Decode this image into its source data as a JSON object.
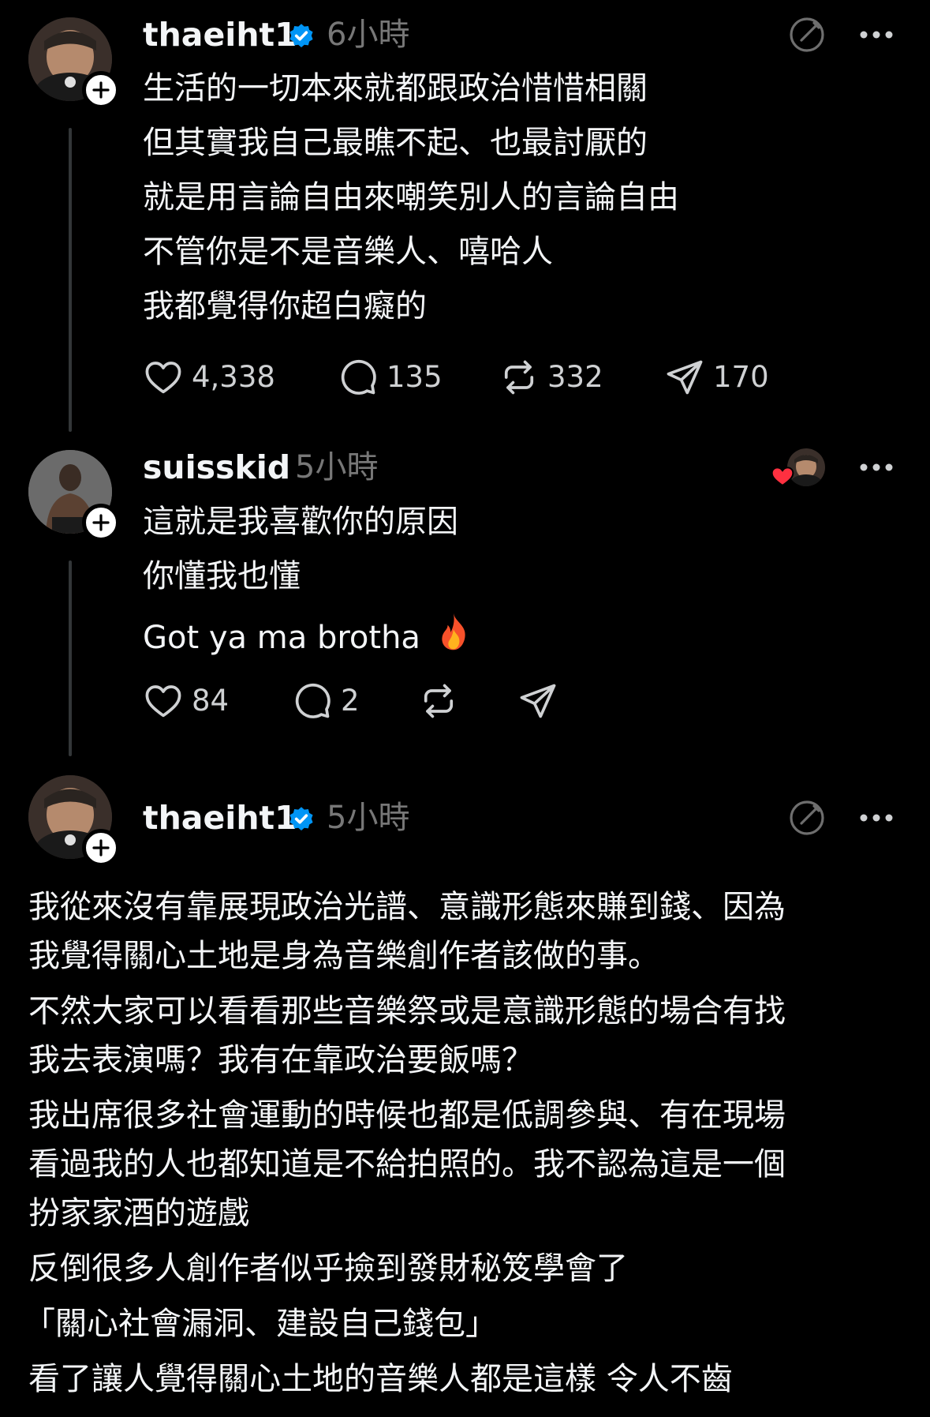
{
  "posts": [
    {
      "username": "thaeiht1",
      "timestamp": "6小時",
      "verified": true,
      "lines": [
        "生活的一切本來就都跟政治惜惜相關",
        "但其實我自己最瞧不起、也最討厭的",
        "就是用言論自由來嘲笑別人的言論自由",
        "不管你是不是音樂人、嘻哈人",
        "我都覺得你超白癡的"
      ],
      "likes": "4,338",
      "replies": "135",
      "reposts": "332",
      "shares": "170"
    },
    {
      "username": "suisskid",
      "timestamp": "5小時",
      "verified": false,
      "lines": [
        "這就是我喜歡你的原因",
        "你懂我也懂",
        "Got ya ma brotha"
      ],
      "emoji": "🔥",
      "likes": "84",
      "replies": "2",
      "reposts": "",
      "shares": ""
    },
    {
      "username": "thaeiht1",
      "timestamp": "5小時",
      "verified": true,
      "lines": [
        "我從來沒有靠展現政治光譜、意識形態來賺到錢、因為",
        "我覺得關心土地是身為音樂創作者該做的事。",
        "不然大家可以看看那些音樂祭或是意識形態的場合有找",
        "我去表演嗎？我有在靠政治要飯嗎？",
        "我出席很多社會運動的時候也都是低調參與、有在現場",
        "看過我的人也都知道是不給拍照的。我不認為這是一個",
        "扮家家酒的遊戲",
        "反倒很多人創作者似乎撿到發財秘笈學會了",
        "「關心社會漏洞、建設自己錢包」",
        "看了讓人覺得關心土地的音樂人都是這樣 令人不齒"
      ]
    }
  ],
  "icons": {
    "like": "heart-icon",
    "reply": "comment-icon",
    "repost": "repost-icon",
    "share": "send-icon",
    "more": "more-options-icon",
    "edit": "edit-icon",
    "follow": "plus-icon",
    "verified": "verified-badge-icon",
    "liked_by_author": "heart-filled-icon"
  },
  "colors": {
    "background": "#000000",
    "text": "#f3f5f7",
    "muted": "#777777",
    "verified": "#0095f6",
    "liked": "#ff3040",
    "thread_line": "#333638"
  }
}
